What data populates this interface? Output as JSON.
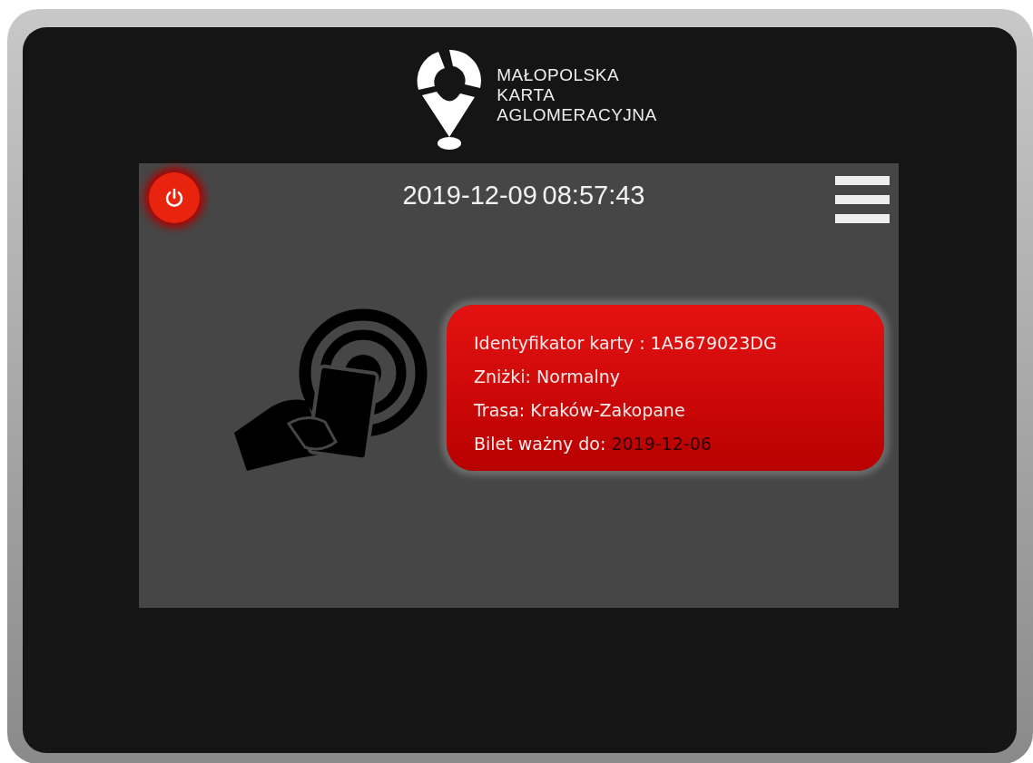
{
  "logo": {
    "lines": [
      "MAŁOPOLSKA",
      "KARTA",
      "AGLOMERACYJNA"
    ]
  },
  "screen": {
    "date": "2019-12-09",
    "time": "08:57:43",
    "card_info": [
      {
        "label": "Identyfikator karty :",
        "value": "1A5679023DG",
        "highlight": false
      },
      {
        "label": "Zniżki:",
        "value": "Normalny",
        "highlight": false
      },
      {
        "label": "Trasa:",
        "value": "Kraków-Zakopane",
        "highlight": false
      },
      {
        "label": "Bilet ważny do:",
        "value": "2019-12-06",
        "highlight": true
      }
    ]
  }
}
